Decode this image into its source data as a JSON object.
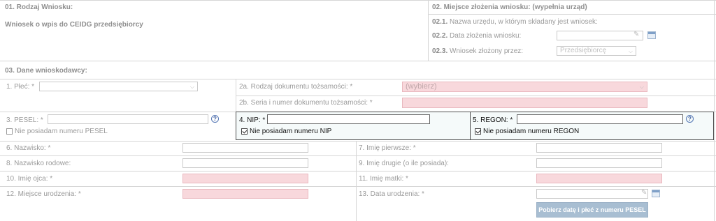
{
  "sec01": {
    "title": "01. Rodzaj Wniosku:",
    "value": "Wniosek o wpis do CEIDG przedsiębiorcy"
  },
  "sec02": {
    "title": "02. Miejsce złożenia wniosku: (wypełnia urząd)",
    "r1": {
      "num": "02.1.",
      "label": "Nazwa urzędu, w którym składany jest wniosek:"
    },
    "r2": {
      "num": "02.2.",
      "label": "Data złożenia wniosku:"
    },
    "r3": {
      "num": "02.3.",
      "label": "Wniosek złożony przez:",
      "value": "Przedsiębiorcę"
    }
  },
  "sec03": {
    "title": "03. Dane wnioskodawcy:",
    "plec": "1. Płeć: *",
    "rodzaj_dok": "2a. Rodzaj dokumentu tożsamości: *",
    "rodzaj_dok_value": "(wybierz)",
    "seria": "2b. Seria i numer dokumentu tożsamości: *",
    "pesel": "3. PESEL: *",
    "no_pesel": "Nie posiadam numeru PESEL",
    "nip": "4. NIP: *",
    "no_nip": "Nie posiadam numeru NIP",
    "regon": "5. REGON: *",
    "no_regon": "Nie posiadam numeru REGON",
    "nazwisko": "6. Nazwisko: *",
    "imie1": "7. Imię pierwsze: *",
    "nazwisko_rodowe": "8. Nazwisko rodowe:",
    "imie2": "9. Imię drugie (o ile posiada):",
    "imie_ojca": "10. Imię ojca: *",
    "imie_matki": "11. Imię matki: *",
    "miejsce_ur": "12. Miejsce urodzenia: *",
    "data_ur": "13. Data urodzenia: *",
    "pesel_button": "Pobierz datę i płeć z numeru PESEL",
    "help_glyph": "?"
  },
  "icons": {
    "pencil": "pencil-icon",
    "calendar": "calendar-icon",
    "help": "help-icon",
    "chevron": "chevron-down-icon"
  }
}
